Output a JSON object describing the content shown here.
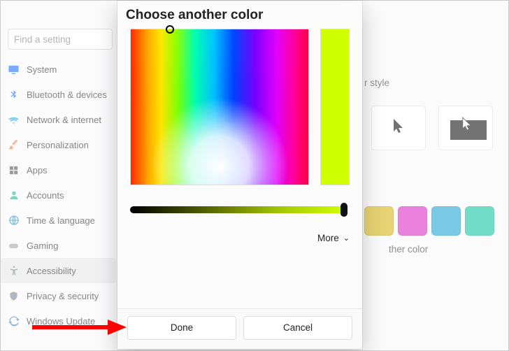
{
  "search": {
    "placeholder": "Find a setting"
  },
  "sidebar": {
    "items": [
      {
        "label": "System",
        "icon": "monitor",
        "color": "#0a66ff"
      },
      {
        "label": "Bluetooth & devices",
        "icon": "bluetooth",
        "color": "#0a66ff"
      },
      {
        "label": "Network & internet",
        "icon": "wifi",
        "color": "#00a1e8"
      },
      {
        "label": "Personalization",
        "icon": "brush",
        "color": "#e7813a"
      },
      {
        "label": "Apps",
        "icon": "grid",
        "color": "#4a4a4a"
      },
      {
        "label": "Accounts",
        "icon": "person",
        "color": "#17b084"
      },
      {
        "label": "Time & language",
        "icon": "globe",
        "color": "#1487c5"
      },
      {
        "label": "Gaming",
        "icon": "gamepad",
        "color": "#9aa0a6"
      },
      {
        "label": "Accessibility",
        "icon": "accessibility",
        "color": "#6f7c8a",
        "active": true
      },
      {
        "label": "Privacy & security",
        "icon": "shield",
        "color": "#6f7c8a"
      },
      {
        "label": "Windows Update",
        "icon": "sync",
        "color": "#1b6fbf"
      }
    ]
  },
  "rightPane": {
    "styleLabel": "r style",
    "swatches": [
      "#d3af00",
      "#d91abf",
      "#0b9dd4",
      "#00c49b"
    ],
    "anotherColorLabel": "ther color"
  },
  "dialog": {
    "title": "Choose another color",
    "selectedColor": "#cfff00",
    "previewGradient": {
      "from": "#000000",
      "to": "#d1ff00"
    },
    "more": "More",
    "done": "Done",
    "cancel": "Cancel"
  }
}
